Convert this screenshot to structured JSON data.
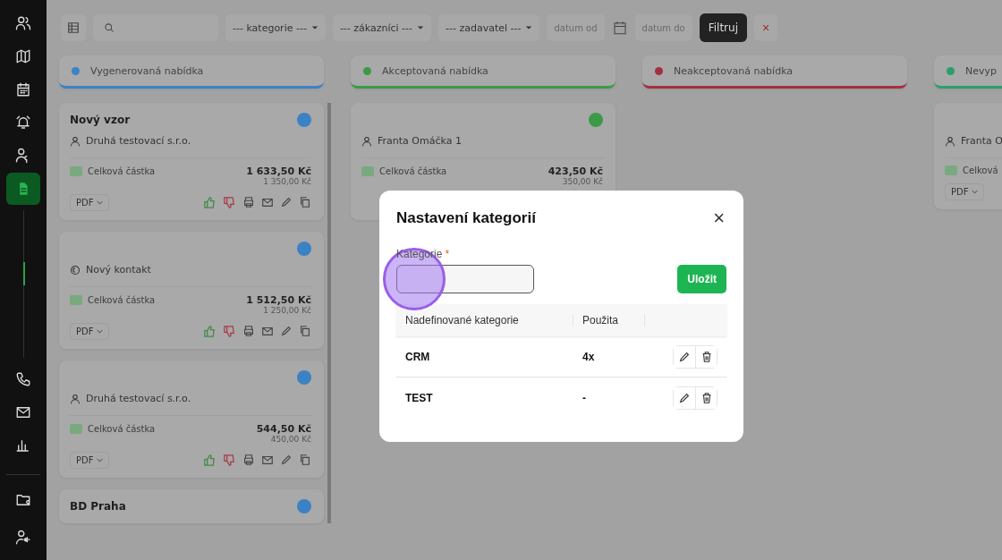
{
  "sidebar": {
    "items": [
      {
        "selected": false
      },
      {
        "selected": false
      },
      {
        "selected": false
      },
      {
        "selected": false
      },
      {
        "selected": false
      },
      {
        "selected": true
      }
    ]
  },
  "toolbar": {
    "filters": [
      {
        "label": "--- kategorie ---"
      },
      {
        "label": "--- zákazníci ---"
      },
      {
        "label": "--- zadavatel ---"
      }
    ],
    "date_from": {
      "placeholder": "datum od"
    },
    "date_to": {
      "placeholder": "datum do"
    },
    "filter_button": "Filtruj",
    "clear_button": "×"
  },
  "columns": [
    {
      "title": "Vygenerovaná nabídka",
      "color": "#3a82c4",
      "cards": [
        {
          "title": "Nový vzor",
          "kind": "person",
          "contact": "Druhá testovací s.r.o.",
          "color": "#3a82c4",
          "total_label": "Celková částka",
          "total": "1 633,50 Kč",
          "subtotal": "1 350,00 Kč",
          "pdf": "PDF"
        },
        {
          "kind": "company",
          "contact": "Nový kontakt",
          "color": "#3a82c4",
          "total_label": "Celková částka",
          "total": "1 512,50 Kč",
          "subtotal": "1 250,00 Kč",
          "pdf": "PDF"
        },
        {
          "kind": "person",
          "contact": "Druhá testovací s.r.o.",
          "color": "#3a82c4",
          "total_label": "Celková částka",
          "total": "544,50 Kč",
          "subtotal": "450,00 Kč",
          "pdf": "PDF"
        },
        {
          "title": "BD Praha",
          "color": "#3a82c4"
        }
      ]
    },
    {
      "title": "Akceptovaná nabídka",
      "color": "#3c9a47",
      "cards": [
        {
          "kind": "person",
          "contact": "Franta Omáčka 1",
          "color": "#3c9a47",
          "total_label": "Celková částka",
          "total": "423,50 Kč",
          "subtotal": "350,00 Kč"
        }
      ]
    },
    {
      "title": "Neakceptovaná nabídka",
      "color": "#a3303f"
    },
    {
      "title": "Nevyp",
      "color": "#2a9f6a",
      "cards": [
        {
          "kind": "person",
          "contact": "Franta O",
          "total_label": "Celková",
          "pdf": "PDF"
        }
      ]
    }
  ],
  "modal": {
    "title": "Nastavení kategorií",
    "close": "×",
    "field": {
      "label": "Kategorie",
      "required_mark": "*"
    },
    "save_button": "Uložit",
    "table": {
      "columns": [
        "Nadefinované kategorie",
        "Použita"
      ],
      "rows": [
        {
          "name": "CRM",
          "used": "4x"
        },
        {
          "name": "TEST",
          "used": "-"
        }
      ]
    }
  }
}
